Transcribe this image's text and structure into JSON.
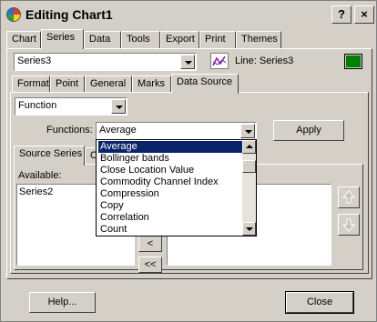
{
  "window": {
    "title": "Editing Chart1",
    "help_btn": "?",
    "close_btn": "×"
  },
  "main_tabs": [
    "Chart",
    "Series",
    "Data",
    "Tools",
    "Export",
    "Print",
    "Themes"
  ],
  "series_selector": {
    "value": "Series3",
    "line_label": "Line: Series3",
    "color": "#008000"
  },
  "sub_tabs": [
    "Format",
    "Point",
    "General",
    "Marks",
    "Data Source"
  ],
  "data_source": {
    "type_value": "Function",
    "functions_label": "Functions:",
    "functions_value": "Average",
    "apply_label": "Apply"
  },
  "source_tabs": [
    "Source Series",
    "O"
  ],
  "available": {
    "label": "Available:",
    "items": [
      "Series2"
    ]
  },
  "function_list": {
    "items": [
      "Average",
      "Bollinger bands",
      "Close Location Value",
      "Commodity Channel Index",
      "Compression",
      "Copy",
      "Correlation",
      "Count"
    ],
    "selected": "Average"
  },
  "move_buttons": {
    "remove_one": "<",
    "remove_all": "<<"
  },
  "footer": {
    "help_label": "Help...",
    "close_label": "Close"
  },
  "colors": {
    "dialog_bg": "#d4d0c8",
    "selection": "#0a246a",
    "series_color": "#008000"
  }
}
